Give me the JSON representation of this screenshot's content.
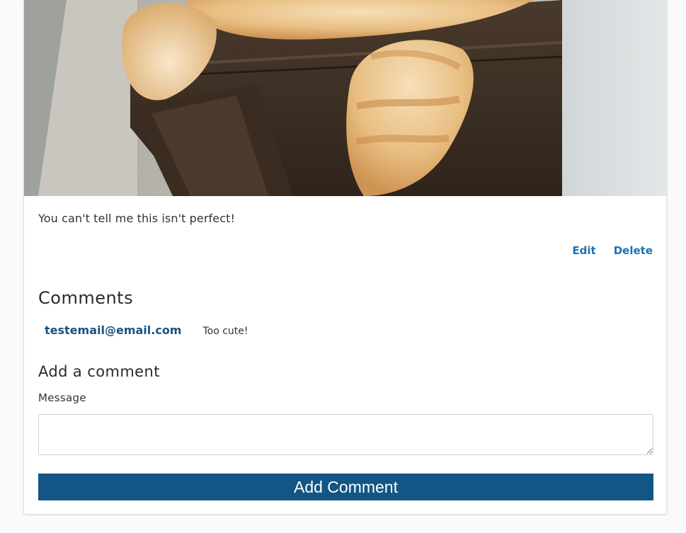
{
  "post": {
    "caption": "You can't tell me this isn't perfect!",
    "edit_label": "Edit",
    "delete_label": "Delete"
  },
  "comments": {
    "heading": "Comments",
    "items": [
      {
        "author": "testemail@email.com",
        "text": "Too cute!"
      }
    ]
  },
  "add_comment": {
    "heading": "Add a comment",
    "message_label": "Message",
    "message_value": "",
    "submit_label": "Add Comment"
  },
  "colors": {
    "link": "#1a73b8",
    "author": "#1a5283",
    "button_bg": "#135584",
    "page_bg": "#fafafa"
  }
}
